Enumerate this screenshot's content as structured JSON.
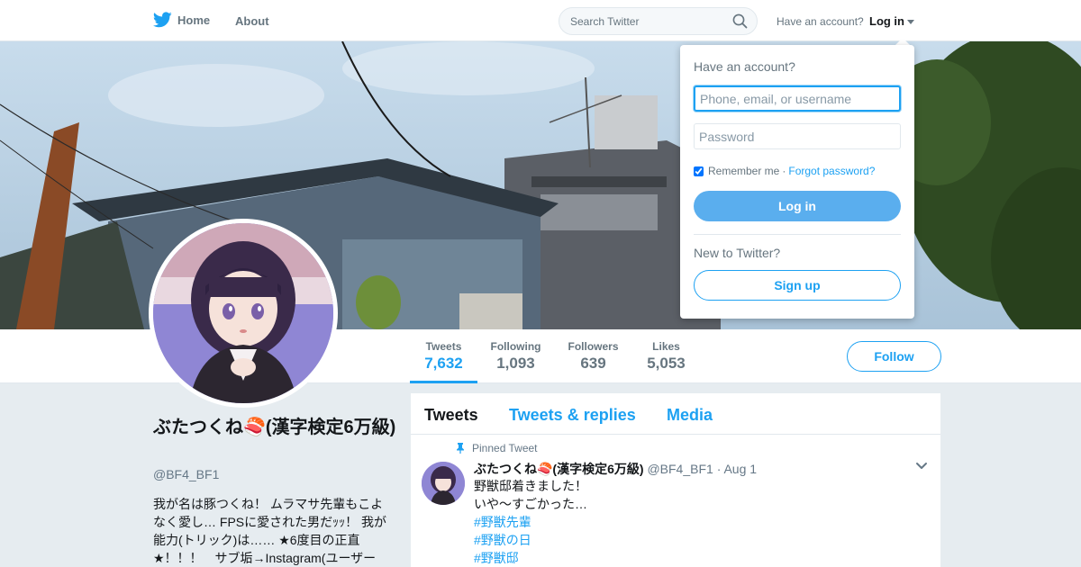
{
  "nav": {
    "home_label": "Home",
    "about_label": "About",
    "search_placeholder": "Search Twitter",
    "have_account": "Have an account?",
    "login_label": "Log in"
  },
  "profile": {
    "name": "ぶたつくね🍣(漢字検定6万級)",
    "handle": "@BF4_BF1",
    "bio": "我が名は豚つくね！ ムラマサ先輩もこよなく愛し… FPSに愛された男だｯｯ！ 我が能力(トリック)は…… ★6度目の正直★！！！　サブ垢→Instagram(ユーザー",
    "follow_label": "Follow"
  },
  "stats": [
    {
      "label": "Tweets",
      "value": "7,632"
    },
    {
      "label": "Following",
      "value": "1,093"
    },
    {
      "label": "Followers",
      "value": "639"
    },
    {
      "label": "Likes",
      "value": "5,053"
    }
  ],
  "timeline": {
    "tabs": [
      "Tweets",
      "Tweets & replies",
      "Media"
    ],
    "pinned_label": "Pinned Tweet",
    "tweet": {
      "name": "ぶたつくね🍣(漢字検定6万級)",
      "handle": "@BF4_BF1",
      "date": "· Aug 1",
      "lines": [
        "野獣邸着きました！",
        "いや〜すごかった…"
      ],
      "hashtags": [
        "#野獣先輩",
        "#野獣の日",
        "#野獣邸"
      ]
    }
  },
  "login_dropdown": {
    "title": "Have an account?",
    "username_placeholder": "Phone, email, or username",
    "password_placeholder": "Password",
    "remember_label": "Remember me",
    "separator": "·",
    "forgot_label": "Forgot password?",
    "login_button": "Log in",
    "new_label": "New to Twitter?",
    "signup_button": "Sign up"
  },
  "colors": {
    "accent": "#1da1f2",
    "login_button": "#5aaeee",
    "background": "#e6ecf0"
  }
}
